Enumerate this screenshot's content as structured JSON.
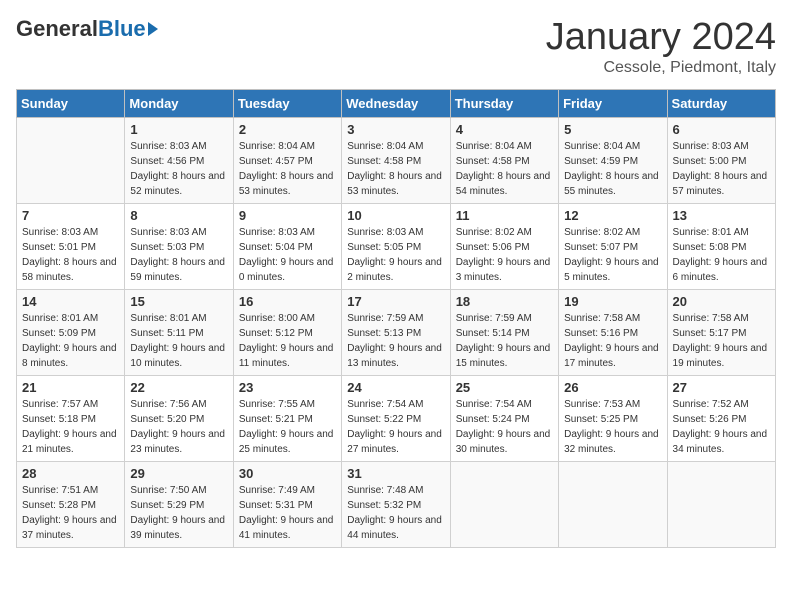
{
  "logo": {
    "general": "General",
    "blue": "Blue"
  },
  "title": "January 2024",
  "subtitle": "Cessole, Piedmont, Italy",
  "days_header": [
    "Sunday",
    "Monday",
    "Tuesday",
    "Wednesday",
    "Thursday",
    "Friday",
    "Saturday"
  ],
  "weeks": [
    [
      {
        "day": "",
        "sunrise": "",
        "sunset": "",
        "daylight": ""
      },
      {
        "day": "1",
        "sunrise": "Sunrise: 8:03 AM",
        "sunset": "Sunset: 4:56 PM",
        "daylight": "Daylight: 8 hours and 52 minutes."
      },
      {
        "day": "2",
        "sunrise": "Sunrise: 8:04 AM",
        "sunset": "Sunset: 4:57 PM",
        "daylight": "Daylight: 8 hours and 53 minutes."
      },
      {
        "day": "3",
        "sunrise": "Sunrise: 8:04 AM",
        "sunset": "Sunset: 4:58 PM",
        "daylight": "Daylight: 8 hours and 53 minutes."
      },
      {
        "day": "4",
        "sunrise": "Sunrise: 8:04 AM",
        "sunset": "Sunset: 4:58 PM",
        "daylight": "Daylight: 8 hours and 54 minutes."
      },
      {
        "day": "5",
        "sunrise": "Sunrise: 8:04 AM",
        "sunset": "Sunset: 4:59 PM",
        "daylight": "Daylight: 8 hours and 55 minutes."
      },
      {
        "day": "6",
        "sunrise": "Sunrise: 8:03 AM",
        "sunset": "Sunset: 5:00 PM",
        "daylight": "Daylight: 8 hours and 57 minutes."
      }
    ],
    [
      {
        "day": "7",
        "sunrise": "Sunrise: 8:03 AM",
        "sunset": "Sunset: 5:01 PM",
        "daylight": "Daylight: 8 hours and 58 minutes."
      },
      {
        "day": "8",
        "sunrise": "Sunrise: 8:03 AM",
        "sunset": "Sunset: 5:03 PM",
        "daylight": "Daylight: 8 hours and 59 minutes."
      },
      {
        "day": "9",
        "sunrise": "Sunrise: 8:03 AM",
        "sunset": "Sunset: 5:04 PM",
        "daylight": "Daylight: 9 hours and 0 minutes."
      },
      {
        "day": "10",
        "sunrise": "Sunrise: 8:03 AM",
        "sunset": "Sunset: 5:05 PM",
        "daylight": "Daylight: 9 hours and 2 minutes."
      },
      {
        "day": "11",
        "sunrise": "Sunrise: 8:02 AM",
        "sunset": "Sunset: 5:06 PM",
        "daylight": "Daylight: 9 hours and 3 minutes."
      },
      {
        "day": "12",
        "sunrise": "Sunrise: 8:02 AM",
        "sunset": "Sunset: 5:07 PM",
        "daylight": "Daylight: 9 hours and 5 minutes."
      },
      {
        "day": "13",
        "sunrise": "Sunrise: 8:01 AM",
        "sunset": "Sunset: 5:08 PM",
        "daylight": "Daylight: 9 hours and 6 minutes."
      }
    ],
    [
      {
        "day": "14",
        "sunrise": "Sunrise: 8:01 AM",
        "sunset": "Sunset: 5:09 PM",
        "daylight": "Daylight: 9 hours and 8 minutes."
      },
      {
        "day": "15",
        "sunrise": "Sunrise: 8:01 AM",
        "sunset": "Sunset: 5:11 PM",
        "daylight": "Daylight: 9 hours and 10 minutes."
      },
      {
        "day": "16",
        "sunrise": "Sunrise: 8:00 AM",
        "sunset": "Sunset: 5:12 PM",
        "daylight": "Daylight: 9 hours and 11 minutes."
      },
      {
        "day": "17",
        "sunrise": "Sunrise: 7:59 AM",
        "sunset": "Sunset: 5:13 PM",
        "daylight": "Daylight: 9 hours and 13 minutes."
      },
      {
        "day": "18",
        "sunrise": "Sunrise: 7:59 AM",
        "sunset": "Sunset: 5:14 PM",
        "daylight": "Daylight: 9 hours and 15 minutes."
      },
      {
        "day": "19",
        "sunrise": "Sunrise: 7:58 AM",
        "sunset": "Sunset: 5:16 PM",
        "daylight": "Daylight: 9 hours and 17 minutes."
      },
      {
        "day": "20",
        "sunrise": "Sunrise: 7:58 AM",
        "sunset": "Sunset: 5:17 PM",
        "daylight": "Daylight: 9 hours and 19 minutes."
      }
    ],
    [
      {
        "day": "21",
        "sunrise": "Sunrise: 7:57 AM",
        "sunset": "Sunset: 5:18 PM",
        "daylight": "Daylight: 9 hours and 21 minutes."
      },
      {
        "day": "22",
        "sunrise": "Sunrise: 7:56 AM",
        "sunset": "Sunset: 5:20 PM",
        "daylight": "Daylight: 9 hours and 23 minutes."
      },
      {
        "day": "23",
        "sunrise": "Sunrise: 7:55 AM",
        "sunset": "Sunset: 5:21 PM",
        "daylight": "Daylight: 9 hours and 25 minutes."
      },
      {
        "day": "24",
        "sunrise": "Sunrise: 7:54 AM",
        "sunset": "Sunset: 5:22 PM",
        "daylight": "Daylight: 9 hours and 27 minutes."
      },
      {
        "day": "25",
        "sunrise": "Sunrise: 7:54 AM",
        "sunset": "Sunset: 5:24 PM",
        "daylight": "Daylight: 9 hours and 30 minutes."
      },
      {
        "day": "26",
        "sunrise": "Sunrise: 7:53 AM",
        "sunset": "Sunset: 5:25 PM",
        "daylight": "Daylight: 9 hours and 32 minutes."
      },
      {
        "day": "27",
        "sunrise": "Sunrise: 7:52 AM",
        "sunset": "Sunset: 5:26 PM",
        "daylight": "Daylight: 9 hours and 34 minutes."
      }
    ],
    [
      {
        "day": "28",
        "sunrise": "Sunrise: 7:51 AM",
        "sunset": "Sunset: 5:28 PM",
        "daylight": "Daylight: 9 hours and 37 minutes."
      },
      {
        "day": "29",
        "sunrise": "Sunrise: 7:50 AM",
        "sunset": "Sunset: 5:29 PM",
        "daylight": "Daylight: 9 hours and 39 minutes."
      },
      {
        "day": "30",
        "sunrise": "Sunrise: 7:49 AM",
        "sunset": "Sunset: 5:31 PM",
        "daylight": "Daylight: 9 hours and 41 minutes."
      },
      {
        "day": "31",
        "sunrise": "Sunrise: 7:48 AM",
        "sunset": "Sunset: 5:32 PM",
        "daylight": "Daylight: 9 hours and 44 minutes."
      },
      {
        "day": "",
        "sunrise": "",
        "sunset": "",
        "daylight": ""
      },
      {
        "day": "",
        "sunrise": "",
        "sunset": "",
        "daylight": ""
      },
      {
        "day": "",
        "sunrise": "",
        "sunset": "",
        "daylight": ""
      }
    ]
  ]
}
